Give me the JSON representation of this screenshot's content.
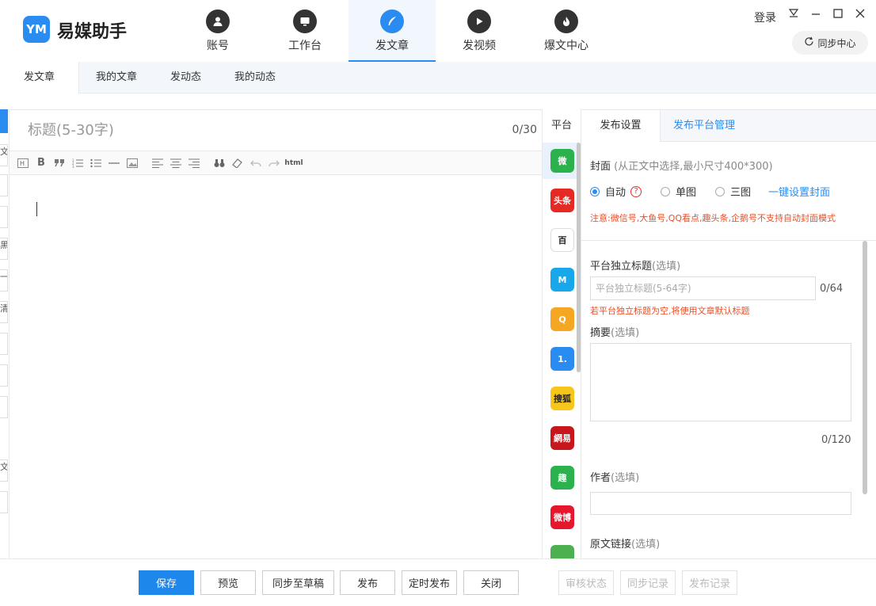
{
  "app": {
    "logo_text": "YM",
    "name": "易媒助手"
  },
  "nav": [
    {
      "label": "账号",
      "icon": "person-icon"
    },
    {
      "label": "工作台",
      "icon": "monitor-icon"
    },
    {
      "label": "发文章",
      "icon": "feather-icon"
    },
    {
      "label": "发视频",
      "icon": "play-icon"
    },
    {
      "label": "爆文中心",
      "icon": "fire-icon"
    }
  ],
  "header": {
    "login": "登录",
    "sync": "同步中心"
  },
  "subtabs": [
    "发文章",
    "我的文章",
    "发动态",
    "我的动态"
  ],
  "gutter_chars": [
    "文",
    "",
    "",
    "黑",
    "一",
    "清",
    "",
    "",
    "",
    "文",
    ""
  ],
  "editor": {
    "title_placeholder": "标题(5-30字)",
    "title_count": "0/30",
    "toolbar_html": "html"
  },
  "platforms": {
    "header": "平台",
    "items": [
      {
        "name": "wechat",
        "text": "微",
        "color": "#2bb24c"
      },
      {
        "name": "toutiao",
        "text": "头条",
        "color": "#e52a25"
      },
      {
        "name": "baijia",
        "text": "百",
        "color": "#ffffff"
      },
      {
        "name": "dayu",
        "text": "M",
        "color": "#18a7e8"
      },
      {
        "name": "qq-kandian",
        "text": "Q",
        "color": "#f5a623"
      },
      {
        "name": "yidian",
        "text": "1.",
        "color": "#2a8cf0"
      },
      {
        "name": "sohu",
        "text": "搜狐",
        "color": "#f7c61a"
      },
      {
        "name": "netease",
        "text": "網易",
        "color": "#c8161d"
      },
      {
        "name": "qutoutiao",
        "text": "趣",
        "color": "#2bb24c"
      },
      {
        "name": "weibo",
        "text": "微博",
        "color": "#e6162d"
      },
      {
        "name": "more",
        "text": "",
        "color": "#4caf50"
      }
    ]
  },
  "settings": {
    "tabs": [
      "发布设置",
      "发布平台管理"
    ],
    "cover_label": "封面",
    "cover_hint": "(从正文中选择,最小尺寸400*300)",
    "radio_auto": "自动",
    "radio_single": "单图",
    "radio_triple": "三图",
    "one_click": "一键设置封面",
    "notice": "注意:微信号,大鱼号,QQ看点,趣头条,企鹅号不支持自动封面模式",
    "title_label": "平台独立标题",
    "optional": "(选填)",
    "title_placeholder": "平台独立标题(5-64字)",
    "title_count": "0/64",
    "title_warn": "若平台独立标题为空,将使用文章默认标题",
    "summary_label": "摘要",
    "summary_count": "0/120",
    "author_label": "作者",
    "source_label": "原文链接"
  },
  "bottom": {
    "save": "保存",
    "preview": "预览",
    "sync_draft": "同步至草稿",
    "publish": "发布",
    "schedule": "定时发布",
    "close": "关闭",
    "review": "审核状态",
    "sync_log": "同步记录",
    "publish_log": "发布记录"
  },
  "colors": {
    "accent": "#2a8cf0",
    "warn": "#e8502a"
  }
}
